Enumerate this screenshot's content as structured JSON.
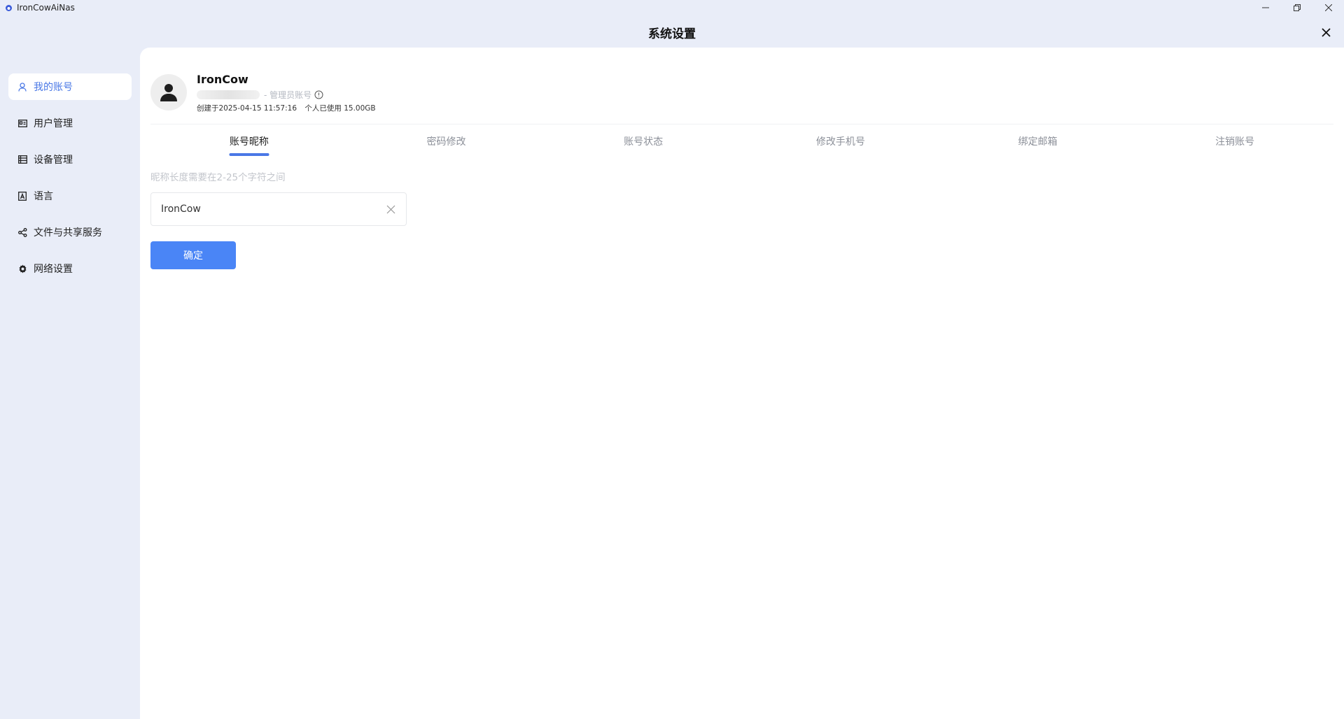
{
  "window": {
    "app_title": "IronCowAiNas",
    "icons": {
      "app": "app-logo-icon",
      "minimize": "minimize-icon",
      "restore": "restore-icon",
      "close": "close-icon"
    }
  },
  "dialog": {
    "title": "系统设置",
    "close_icon": "close-icon"
  },
  "sidebar": {
    "items": [
      {
        "label": "我的账号",
        "icon": "user-icon",
        "active": true
      },
      {
        "label": "用户管理",
        "icon": "id-card-icon",
        "active": false
      },
      {
        "label": "设备管理",
        "icon": "device-list-icon",
        "active": false
      },
      {
        "label": "语言",
        "icon": "language-icon",
        "active": false
      },
      {
        "label": "文件与共享服务",
        "icon": "share-icon",
        "active": false
      },
      {
        "label": "网络设置",
        "icon": "gear-icon",
        "active": false
      }
    ]
  },
  "profile": {
    "username": "IronCow",
    "role": "- 管理员账号",
    "created": "创建于2025-04-15 11:57:16",
    "usage": "个人已使用 15.00GB"
  },
  "tabs": [
    {
      "label": "账号昵称",
      "active": true
    },
    {
      "label": "密码修改",
      "active": false
    },
    {
      "label": "账号状态",
      "active": false
    },
    {
      "label": "修改手机号",
      "active": false
    },
    {
      "label": "绑定邮箱",
      "active": false
    },
    {
      "label": "注销账号",
      "active": false
    }
  ],
  "nickname_form": {
    "hint": "昵称长度需要在2-25个字符之间",
    "value": "IronCow",
    "confirm_label": "确定"
  },
  "colors": {
    "accent": "#4a78e6",
    "button": "#4a85f6",
    "background": "#e9edf8"
  }
}
